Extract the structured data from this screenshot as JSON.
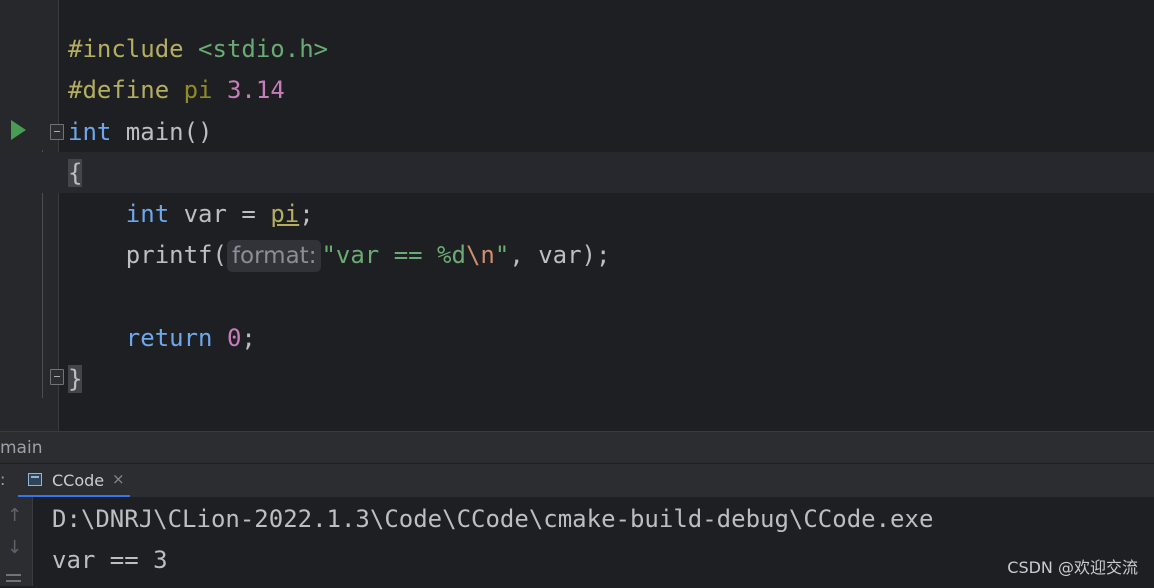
{
  "editor": {
    "include_kw": "#include",
    "include_file": "<stdio.h>",
    "define_kw": "#define",
    "define_name": "pi",
    "define_value": "3.14",
    "int_kw": "int",
    "main_sig": " main()",
    "open_brace": "{",
    "var_type": "int",
    "var_decl": " var = ",
    "var_value": "pi",
    "semicolon": ";",
    "printf_fn": "printf(",
    "param_hint": "format:",
    "fmt_open": "\"var == ",
    "fmt_spec": "%d",
    "fmt_esc": "\\n",
    "fmt_close": "\"",
    "printf_tail": ", var);",
    "return_kw": "return",
    "return_space": " ",
    "return_value": "0",
    "return_semicolon": ";",
    "close_brace": "}"
  },
  "breadcrumb": {
    "label": "main"
  },
  "run_panel": {
    "colon": ":",
    "tab_label": "CCode",
    "tab_close": "×",
    "output_path": "D:\\DNRJ\\CLion-2022.1.3\\Code\\CCode\\cmake-build-debug\\CCode.exe",
    "output_result": "var == 3",
    "up_arrow": "↑",
    "down_arrow": "↓"
  },
  "watermark": "CSDN @欢迎交流",
  "icons": [
    "run-gutter-icon",
    "fold-start-icon",
    "fold-end-icon",
    "console-tab-icon",
    "close-icon",
    "scroll-up-icon",
    "scroll-down-icon",
    "soft-wrap-icon"
  ]
}
